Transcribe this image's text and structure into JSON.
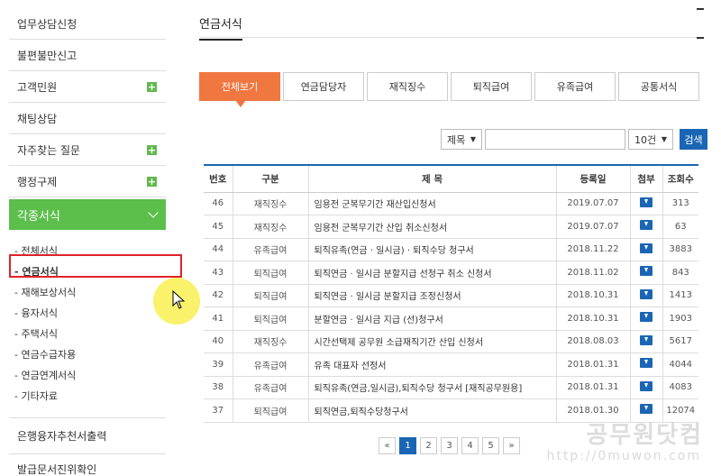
{
  "sidebar": {
    "top_items": [
      {
        "label": "업무상담신청",
        "plus": false
      },
      {
        "label": "불편불만신고",
        "plus": false
      },
      {
        "label": "고객민원",
        "plus": true
      },
      {
        "label": "채팅상담",
        "plus": false
      },
      {
        "label": "자주찾는 질문",
        "plus": true
      },
      {
        "label": "행정구제",
        "plus": true
      }
    ],
    "active_item": "각종서식",
    "sub_items": [
      "- 전체서식",
      "- 연금서식",
      "- 재해보상서식",
      "- 융자서식",
      "- 주택서식",
      "- 연금수급자용",
      "- 연금연계서식",
      "- 기타자료"
    ],
    "bottom_items": [
      "은행융자추천서출력",
      "발급문서진위확인"
    ]
  },
  "main": {
    "title": "연금서식",
    "tabs": [
      "전체보기",
      "연금담당자",
      "재직징수",
      "퇴직급여",
      "유족급여",
      "공통서식"
    ],
    "search": {
      "type_value": "제목",
      "count_value": "10건",
      "button": "검색"
    },
    "table": {
      "headers": [
        "번호",
        "구분",
        "제 목",
        "등록일",
        "첨부",
        "조회수"
      ],
      "rows": [
        [
          "46",
          "재직징수",
          "임용전 군복무기간 재산입신청서",
          "2019.07.07",
          "313"
        ],
        [
          "45",
          "재직징수",
          "임용전 군복무기간 산입 취소신청서",
          "2019.07.07",
          "63"
        ],
        [
          "44",
          "유족급여",
          "퇴직유족(연금 · 일시금) · 퇴직수당 청구서",
          "2018.11.22",
          "3883"
        ],
        [
          "43",
          "퇴직급여",
          "퇴직연금 · 일시금 분할지급 선청구 취소 신청서",
          "2018.11.02",
          "843"
        ],
        [
          "42",
          "퇴직급여",
          "퇴직연금 · 일시금 분할지급 조정신청서",
          "2018.10.31",
          "1413"
        ],
        [
          "41",
          "퇴직급여",
          "분할연금 · 일시금 지급 (선)청구서",
          "2018.10.31",
          "1903"
        ],
        [
          "40",
          "재직징수",
          "시간선택제 공무원 소급재직기간 산입 신청서",
          "2018.08.03",
          "5617"
        ],
        [
          "39",
          "유족급여",
          "유족 대표자 선정서",
          "2018.01.31",
          "4044"
        ],
        [
          "38",
          "유족급여",
          "퇴직유족(연금,일시금),퇴직수당 청구서 [재직공무원용]",
          "2018.01.31",
          "4083"
        ],
        [
          "37",
          "퇴직급여",
          "퇴직연금,퇴직수당청구서",
          "2018.01.30",
          "12074"
        ]
      ]
    },
    "pager": {
      "prev": "«",
      "pages": [
        "1",
        "2",
        "3",
        "4",
        "5"
      ],
      "next": "»",
      "current": "1"
    }
  },
  "watermark": {
    "text": "공무원닷컴",
    "url": "http://0muwon.com"
  },
  "colors": {
    "accent": "#f0773f",
    "active_green": "#5cbf4c",
    "blue": "#1b66b4",
    "highlight": "#e0222a"
  }
}
